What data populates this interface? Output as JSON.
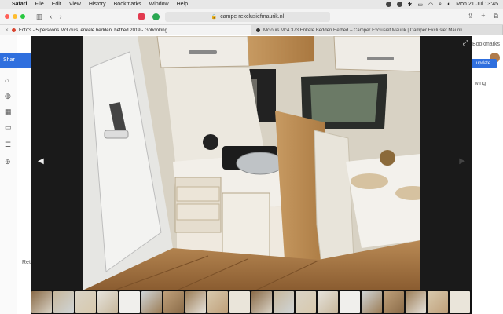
{
  "menubar": {
    "app": "Safari",
    "items": [
      "File",
      "Edit",
      "View",
      "History",
      "Bookmarks",
      "Window",
      "Help"
    ],
    "clock": "Mon 21 Jul  13:45"
  },
  "toolbar": {
    "url": "campe rexclusiefmaurik.nl"
  },
  "tabs": [
    {
      "title": "Foto's - 5 persoons McLouis, enkele bedden, hefbed 2019 - Gobooking",
      "active": true,
      "favicon_color": "#d9442f"
    },
    {
      "title": "Mclouis Mc4 373 Enkele Bedden Hefbed – Camper Exclusief Maurik | Camper Exclusief Maurik",
      "active": false,
      "favicon_color": "#333333"
    }
  ],
  "background_page": {
    "sidebar_label": "Shar",
    "update_button": "update",
    "bookmarks_text": "Bookmarks",
    "side_text": "wing",
    "bottom_text": "Retu"
  },
  "viewer": {
    "prev_icon": "chevron-left-icon",
    "next_icon": "chevron-right-icon",
    "fullscreen_icon": "expand-icon",
    "thumbnail_count": 20
  },
  "colors": {
    "accent": "#2f6fde",
    "traffic_red": "#ff5f57",
    "traffic_yellow": "#febc2e",
    "traffic_green": "#28c840"
  }
}
